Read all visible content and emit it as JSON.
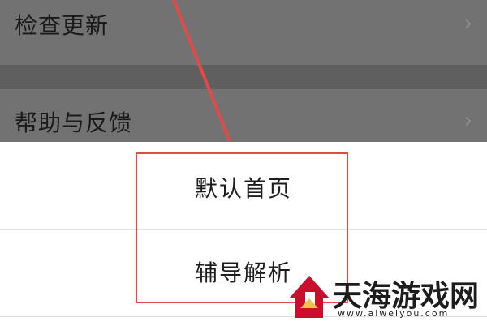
{
  "settings": {
    "rows": [
      {
        "label": "检查更新",
        "chevron": "›"
      },
      {
        "label": "帮助与反馈",
        "chevron": "›"
      }
    ]
  },
  "sheet": {
    "options": [
      {
        "label": "默认首页"
      },
      {
        "label": "辅导解析"
      }
    ]
  },
  "annotation": {
    "color": "#e14a4a"
  },
  "watermark": {
    "text": "天海游戏网",
    "url": "www.aiweiyou.com",
    "logo_icon": "house-logo-icon",
    "logo_color": "#c8102e"
  }
}
